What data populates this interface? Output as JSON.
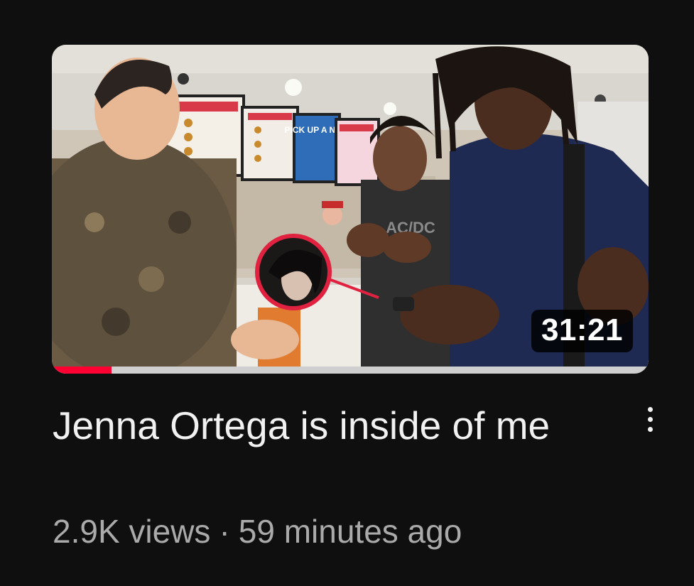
{
  "video": {
    "title": "Jenna Ortega is inside of me",
    "duration": "31:21",
    "views": "2.9K views",
    "separator": "·",
    "age": "59 minutes ago",
    "watch_progress_fraction": 0.1
  },
  "thumbnail": {
    "menu_board_text": "PICK UP A NEW",
    "shirt_text": "AC/DC"
  },
  "colors": {
    "background": "#0f0f0f",
    "title": "#f1f1f1",
    "meta": "#aaaaaa",
    "progress": "#ff0033",
    "progress_track": "#cfcfcf"
  },
  "icons": {
    "more": "more-vertical-icon"
  }
}
